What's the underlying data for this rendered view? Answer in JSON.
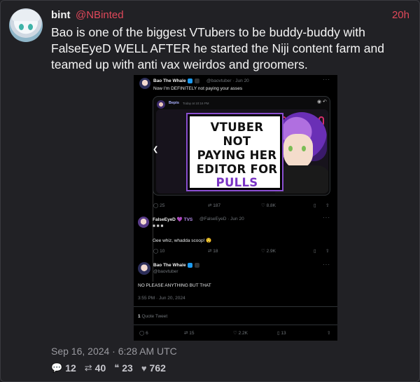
{
  "post": {
    "author_name": "bint",
    "author_handle": "@NBinted",
    "time_ago": "20h",
    "text": "Bao is one of the biggest VTubers to be buddy-buddy with FalseEyeD WELL AFTER he started the Niji content farm and teamed up with anti vax weirdos and groomers.",
    "date": "Sep 16, 2024 · 6:28 AM UTC",
    "stats": {
      "replies": "12",
      "reposts": "40",
      "quotes": "23",
      "likes": "762"
    }
  },
  "embed": {
    "tweet1": {
      "name": "Bao The Whale",
      "badges": "🐳",
      "handle_time": "@baovtuber · Jun 20",
      "text": "Now I'm DEFINITELY not paying your asses",
      "quote": {
        "name": "Bepis",
        "meta": "Today at 10:16 PM",
        "thumb_lines": [
          "VTUBER",
          "NOT",
          "PAYING HER",
          "EDITOR FOR",
          "PULLS"
        ]
      },
      "actions": {
        "replies": "25",
        "reposts": "187",
        "likes": "8.8K"
      }
    },
    "tweet2": {
      "name": "FalseEyeD",
      "badges": "💜 TVS",
      "handle_time": "@FalseEyeD · Jun 20",
      "text": "Gee whiz, whadda scoop! 😲",
      "actions": {
        "replies": "10",
        "reposts": "18",
        "likes": "2.9K"
      }
    },
    "tweet3": {
      "name": "Bao The Whale",
      "badges": "🐳",
      "handle": "@baovtuber",
      "text": "NO PLEASE ANYTHING BUT THAT",
      "timestamp": "3:55 PM · Jun 20, 2024",
      "quote_count": "1",
      "quote_label": "Quote Tweet",
      "actions": {
        "replies": "6",
        "reposts": "15",
        "likes": "2.2K",
        "bookmarks": "13"
      }
    }
  },
  "colors": {
    "accent": "#e0485a",
    "background": "#212125",
    "purple": "#7a35c4"
  },
  "icons": {
    "replies": "comment-icon",
    "reposts": "retweet-icon",
    "quotes": "quote-icon",
    "likes": "heart-icon"
  }
}
